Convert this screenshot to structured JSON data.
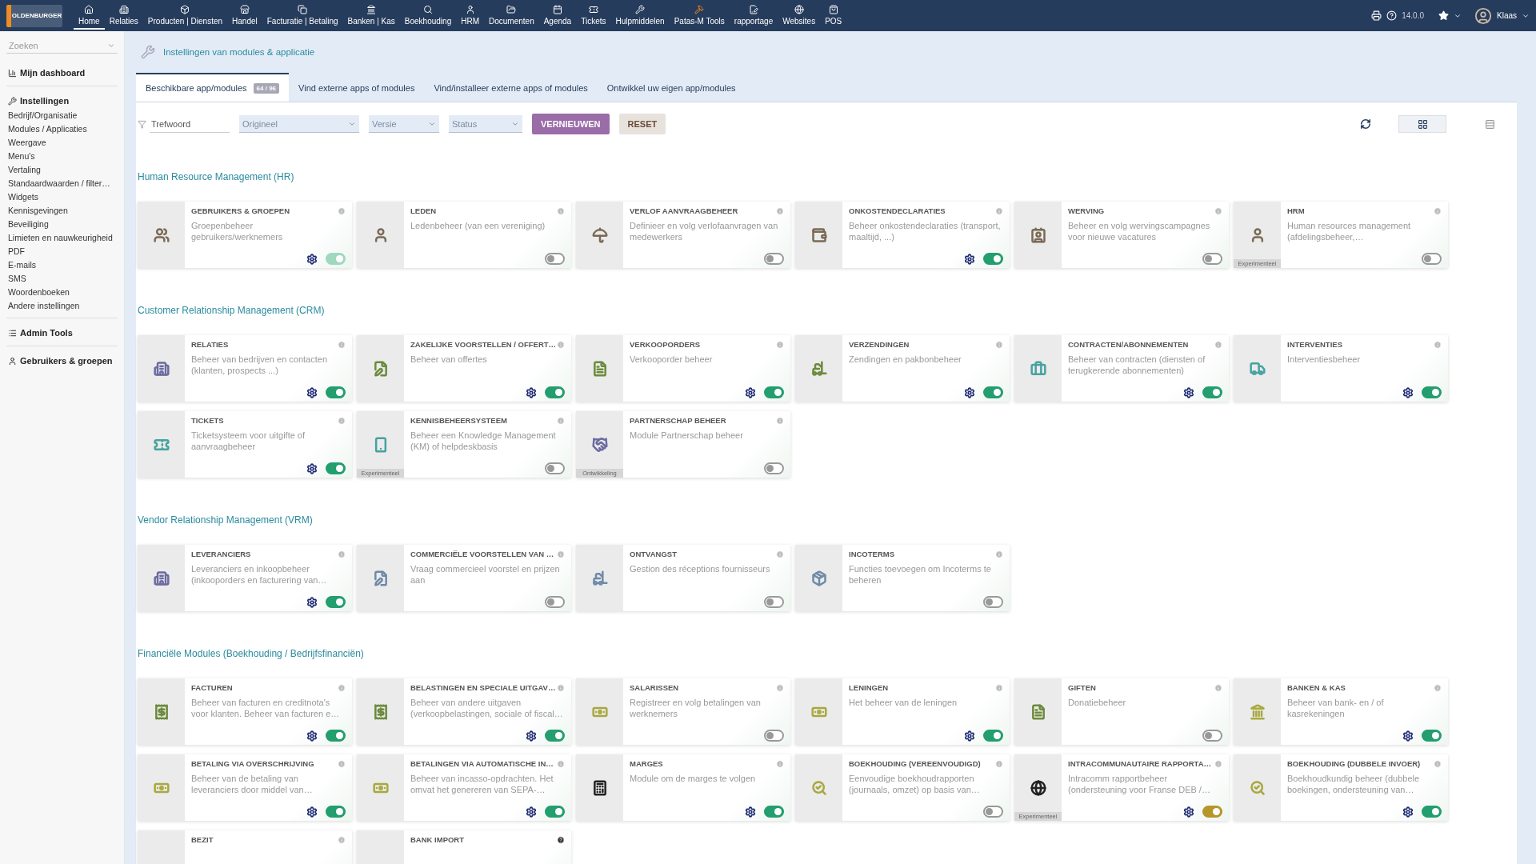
{
  "top_bar": {
    "logo": "OLDENBURGER",
    "menu": [
      {
        "label": "Home",
        "selected": true
      },
      {
        "label": "Relaties",
        "selected": false
      },
      {
        "label": "Producten | Diensten",
        "selected": false
      },
      {
        "label": "Handel",
        "selected": false
      },
      {
        "label": "Facturatie | Betaling",
        "selected": false
      },
      {
        "label": "Banken | Kas",
        "selected": false
      },
      {
        "label": "Boekhouding",
        "selected": false
      },
      {
        "label": "HRM",
        "selected": false
      },
      {
        "label": "Documenten",
        "selected": false
      },
      {
        "label": "Agenda",
        "selected": false
      },
      {
        "label": "Tickets",
        "selected": false
      },
      {
        "label": "Hulpmiddelen",
        "selected": false
      },
      {
        "label": "Patas-M Tools",
        "selected": false
      },
      {
        "label": "rapportage",
        "selected": false
      },
      {
        "label": "Websites",
        "selected": false
      },
      {
        "label": "POS",
        "selected": false
      }
    ],
    "version": "14.0.0",
    "user": "Klaas"
  },
  "sidebar": {
    "search_placeholder": "Zoeken",
    "groups": [
      {
        "title": "Mijn dashboard"
      },
      {
        "title": "Instellingen",
        "items": [
          "Bedrijf/Organisatie",
          "Modules / Applicaties",
          "Weergave",
          "Menu's",
          "Vertaling",
          "Standaardwaarden / filter…",
          "Widgets",
          "Kennisgevingen",
          "Beveiliging",
          "Limieten en nauwkeurigheid",
          "PDF",
          "E-mails",
          "SMS",
          "Woordenboeken",
          "Andere instellingen"
        ]
      },
      {
        "title": "Admin Tools"
      },
      {
        "title": "Gebruikers & groepen"
      }
    ]
  },
  "page_title": "Instellingen van modules & applicatie",
  "tabs": [
    {
      "label": "Beschikbare app/modules",
      "count": "64 / 96",
      "selected": true
    },
    {
      "label": "Vind externe apps of modules",
      "selected": false
    },
    {
      "label": "Vind/installeer externe apps of modules",
      "selected": false
    },
    {
      "label": "Ontwikkel uw eigen app/modules",
      "selected": false
    }
  ],
  "filters": {
    "keyword_placeholder": "Trefwoord",
    "selects": [
      "Origineel",
      "Versie",
      "Status"
    ],
    "buttons": [
      {
        "label": "VERNIEUWEN",
        "kind": "primary"
      },
      {
        "label": "RESET",
        "kind": "secondary"
      }
    ]
  },
  "view_modes": [
    {
      "selected": true
    },
    {
      "selected": false
    }
  ],
  "sections": [
    {
      "title": "Human Resource Management (HR)",
      "modules": [
        {
          "title": "GEBRUIKERS & GROEPEN",
          "description": "Groepenbeheer gebruikers/werknemers",
          "color": "#7a6a55",
          "settings": true,
          "toggle": {
            "on": true,
            "color": "#9fd8bf"
          }
        },
        {
          "title": "LEDEN",
          "description": "Ledenbeheer (van een vereniging)",
          "color": "#7a6a55",
          "settings": false,
          "toggle": {
            "on": false
          }
        },
        {
          "title": "VERLOF AANVRAAGBEHEER",
          "description": "Definieer en volg verlofaanvragen van medewerkers",
          "color": "#7a6a55",
          "settings": false,
          "toggle": {
            "on": false
          }
        },
        {
          "title": "ONKOSTENDECLARATIES",
          "description": "Beheer onkostendeclaraties (transport, maaltijd, ...)",
          "color": "#7a6a55",
          "settings": true,
          "toggle": {
            "on": true,
            "color": "#229e6f"
          }
        },
        {
          "title": "WERVING",
          "description": "Beheer en volg wervingscampagnes voor nieuwe vacatures",
          "color": "#7a6a55",
          "settings": false,
          "toggle": {
            "on": false
          }
        },
        {
          "title": "HRM",
          "description": "Human resources management (afdelingsbeheer,…",
          "color": "#7a6a55",
          "settings": false,
          "toggle": {
            "on": false
          },
          "badge": "Experimenteel"
        }
      ]
    },
    {
      "title": "Customer Relationship Management (CRM)",
      "modules": [
        {
          "title": "RELATIES",
          "description": "Beheer van bedrijven en contacten (klanten, prospects ...)",
          "color": "#6c6aa0",
          "settings": true,
          "toggle": {
            "on": true,
            "color": "#229e6f"
          }
        },
        {
          "title": "ZAKELIJKE VOORSTELLEN / OFFERT…",
          "description": "Beheer van offertes",
          "color": "#6c8a3c",
          "settings": true,
          "toggle": {
            "on": true,
            "color": "#229e6f"
          }
        },
        {
          "title": "VERKOOPORDERS",
          "description": "Verkooporder beheer",
          "color": "#6c8a3c",
          "settings": true,
          "toggle": {
            "on": true,
            "color": "#229e6f"
          }
        },
        {
          "title": "VERZENDINGEN",
          "description": "Zendingen en pakbonbeheer",
          "color": "#6c8a3c",
          "settings": true,
          "toggle": {
            "on": true,
            "color": "#229e6f"
          }
        },
        {
          "title": "CONTRACTEN/ABONNEMENTEN",
          "description": "Beheer van contracten (diensten of terugkerende abonnementen)",
          "color": "#46a2a0",
          "settings": true,
          "toggle": {
            "on": true,
            "color": "#229e6f"
          }
        },
        {
          "title": "INTERVENTIES",
          "description": "Interventiesbeheer",
          "color": "#46a2a0",
          "settings": true,
          "toggle": {
            "on": true,
            "color": "#229e6f"
          }
        },
        {
          "title": "TICKETS",
          "description": "Ticketsysteem voor uitgifte of aanvraagbeheer",
          "color": "#46a2a0",
          "settings": true,
          "toggle": {
            "on": true,
            "color": "#229e6f"
          }
        },
        {
          "title": "KENNISBEHEERSYSTEEM",
          "description": "Beheer een Knowledge Management (KM) of helpdeskbasis",
          "color": "#46a2a0",
          "settings": false,
          "toggle": {
            "on": false
          },
          "badge": "Experimenteel"
        },
        {
          "title": "PARTNERSCHAP BEHEER",
          "description": "Module Partnerschap beheer",
          "color": "#6c6aa0",
          "settings": false,
          "toggle": {
            "on": false
          },
          "badge": "Ontwikkeling"
        }
      ]
    },
    {
      "title": "Vendor Relationship Management (VRM)",
      "modules": [
        {
          "title": "LEVERANCIERS",
          "description": "Leveranciers en inkoopbeheer (inkooporders en facturering van…",
          "color": "#6c6aa0",
          "settings": true,
          "toggle": {
            "on": true,
            "color": "#229e6f"
          }
        },
        {
          "title": "COMMERCIËLE VOORSTELLEN VAN …",
          "description": "Vraag commercieel voorstel en prijzen aan",
          "color": "#6e8aa8",
          "settings": false,
          "toggle": {
            "on": false
          }
        },
        {
          "title": "ONTVANGST",
          "description": "Gestion des réceptions fournisseurs",
          "color": "#6e8aa8",
          "settings": false,
          "toggle": {
            "on": false
          }
        },
        {
          "title": "INCOTERMS",
          "description": "Functies toevoegen om Incoterms te beheren",
          "color": "#6e8aa8",
          "settings": false,
          "toggle": {
            "on": false
          }
        }
      ]
    },
    {
      "title": "Financiële Modules (Boekhouding / Bedrijfsfinanciën)",
      "modules": [
        {
          "title": "FACTUREN",
          "description": "Beheer van facturen en creditnota's voor klanten. Beheer van facturen e…",
          "color": "#6c8a3c",
          "settings": true,
          "toggle": {
            "on": true,
            "color": "#229e6f"
          }
        },
        {
          "title": "BELASTINGEN EN SPECIALE UITGAV…",
          "description": "Beheer van andere uitgaven (verkoopbelastingen, sociale of fiscal…",
          "color": "#6c8a3c",
          "settings": true,
          "toggle": {
            "on": true,
            "color": "#229e6f"
          }
        },
        {
          "title": "SALARISSEN",
          "description": "Registreer en volg betalingen van werknemers",
          "color": "#a8a840",
          "settings": false,
          "toggle": {
            "on": false
          }
        },
        {
          "title": "LENINGEN",
          "description": "Het beheer van de leningen",
          "color": "#a8a840",
          "settings": true,
          "toggle": {
            "on": true,
            "color": "#229e6f"
          }
        },
        {
          "title": "GIFTEN",
          "description": "Donatiebeheer",
          "color": "#6c8a3c",
          "settings": false,
          "toggle": {
            "on": false
          }
        },
        {
          "title": "BANKEN & KAS",
          "description": "Beheer van bank- en / of kasrekeningen",
          "color": "#a8a840",
          "settings": true,
          "toggle": {
            "on": true,
            "color": "#229e6f"
          }
        },
        {
          "title": "BETALING VIA OVERSCHRIJVING",
          "description": "Beheer van de betaling van leveranciers door middel van…",
          "color": "#a8a840",
          "settings": true,
          "toggle": {
            "on": true,
            "color": "#229e6f"
          }
        },
        {
          "title": "BETALINGEN VIA AUTOMATISCHE IN…",
          "description": "Beheer van incasso-opdrachten. Het omvat het genereren van SEPA-…",
          "color": "#a8a840",
          "settings": true,
          "toggle": {
            "on": true,
            "color": "#229e6f"
          }
        },
        {
          "title": "MARGES",
          "description": "Module om de marges te volgen",
          "color": "#222222",
          "settings": true,
          "toggle": {
            "on": true,
            "color": "#229e6f"
          }
        },
        {
          "title": "BOEKHOUDING (VEREENVOUDIGD)",
          "description": "Eenvoudige boekhoudrapporten (journaals, omzet) op basis van…",
          "color": "#a8a840",
          "settings": false,
          "toggle": {
            "on": false
          }
        },
        {
          "title": "INTRACOMMUNAUTAIRE RAPPORTA…",
          "description": "Intracomm rapportbeheer (ondersteuning voor Franse DEB /…",
          "color": "#222222",
          "settings": true,
          "toggle": {
            "on": true,
            "color": "#b8952a"
          },
          "badge": "Experimenteel"
        },
        {
          "title": "BOEKHOUDING (DUBBELE INVOER)",
          "description": "Boekhoudkundig beheer (dubbele boekingen, ondersteuning van…",
          "color": "#a8a840",
          "settings": true,
          "toggle": {
            "on": true,
            "color": "#229e6f"
          }
        },
        {
          "title": "BEZIT"
        },
        {
          "title": "BANK IMPORT",
          "help": true
        }
      ]
    }
  ]
}
